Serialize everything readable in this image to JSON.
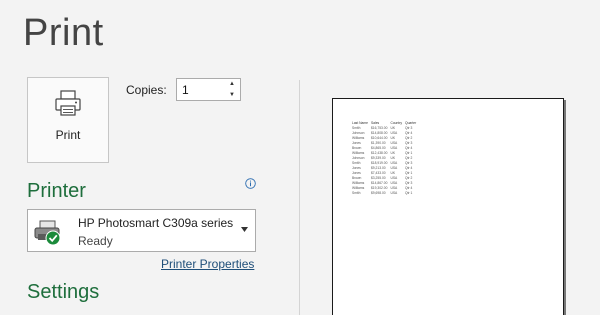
{
  "page": {
    "title": "Print"
  },
  "print_button": {
    "label": "Print",
    "icon": "printer-icon"
  },
  "copies": {
    "label": "Copies:",
    "value": "1"
  },
  "printer": {
    "heading": "Printer",
    "name": "HP Photosmart C309a series",
    "status": "Ready",
    "properties_link": "Printer Properties",
    "status_color": "#1b8a3b"
  },
  "settings": {
    "heading": "Settings"
  },
  "accent_color": "#1e6e3c",
  "preview": {
    "headers": [
      "Last Name",
      "Sales",
      "Country",
      "Quarter"
    ],
    "rows": [
      [
        "Smith",
        "$16,753.00",
        "UK",
        "Qtr 3"
      ],
      [
        "Johnson",
        "$14,808.00",
        "USA",
        "Qtr 4"
      ],
      [
        "Williams",
        "$10,644.00",
        "UK",
        "Qtr 2"
      ],
      [
        "Jones",
        "$1,390.00",
        "USA",
        "Qtr 3"
      ],
      [
        "Brown",
        "$4,865.00",
        "USA",
        "Qtr 4"
      ],
      [
        "Williams",
        "$12,438.00",
        "UK",
        "Qtr 1"
      ],
      [
        "Johnson",
        "$9,339.00",
        "UK",
        "Qtr 2"
      ],
      [
        "Smith",
        "$18,919.00",
        "USA",
        "Qtr 3"
      ],
      [
        "Jones",
        "$9,213.00",
        "USA",
        "Qtr 4"
      ],
      [
        "Jones",
        "$7,433.00",
        "UK",
        "Qtr 1"
      ],
      [
        "Brown",
        "$3,255.00",
        "USA",
        "Qtr 2"
      ],
      [
        "Williams",
        "$14,867.00",
        "USA",
        "Qtr 3"
      ],
      [
        "Williams",
        "$19,302.00",
        "USA",
        "Qtr 4"
      ],
      [
        "Smith",
        "$9,698.00",
        "USA",
        "Qtr 1"
      ]
    ]
  }
}
